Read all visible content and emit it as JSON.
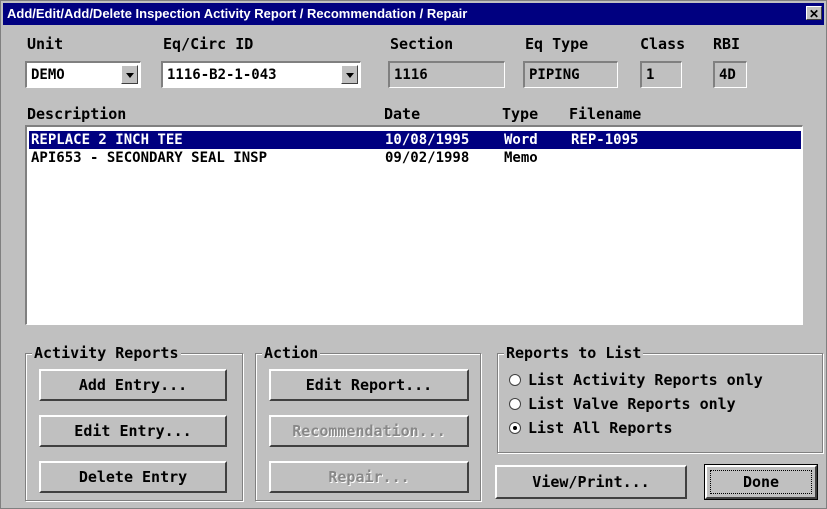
{
  "window": {
    "title": "Add/Edit/Add/Delete Inspection Activity Report / Recommendation / Repair",
    "close_glyph": "✕"
  },
  "header": {
    "unit_label": "Unit",
    "unit_value": "DEMO",
    "eqcirc_label": "Eq/Circ ID",
    "eqcirc_value": "1116-B2-1-043",
    "section_label": "Section",
    "section_value": "1116",
    "eqtype_label": "Eq Type",
    "eqtype_value": "PIPING",
    "class_label": "Class",
    "class_value": "1",
    "rbi_label": "RBI",
    "rbi_value": "4D"
  },
  "list": {
    "columns": [
      "Description",
      "Date",
      "Type",
      "Filename"
    ],
    "rows": [
      {
        "description": "REPLACE 2 INCH TEE",
        "date": "10/08/1995",
        "type": "Word",
        "filename": "REP-1095",
        "selected": true
      },
      {
        "description": "API653 - SECONDARY SEAL INSP",
        "date": "09/02/1998",
        "type": "Memo",
        "filename": "",
        "selected": false
      }
    ]
  },
  "activity_reports": {
    "title": "Activity Reports",
    "add": "Add Entry...",
    "edit": "Edit Entry...",
    "delete": "Delete Entry"
  },
  "action": {
    "title": "Action",
    "edit_report": "Edit Report...",
    "recommendation": "Recommendation...",
    "repair": "Repair..."
  },
  "reports_to_list": {
    "title": "Reports to List",
    "options": [
      "List Activity Reports only",
      "List Valve Reports only",
      "List All Reports"
    ],
    "selected_index": 2
  },
  "footer": {
    "view_print": "View/Print...",
    "done": "Done"
  }
}
